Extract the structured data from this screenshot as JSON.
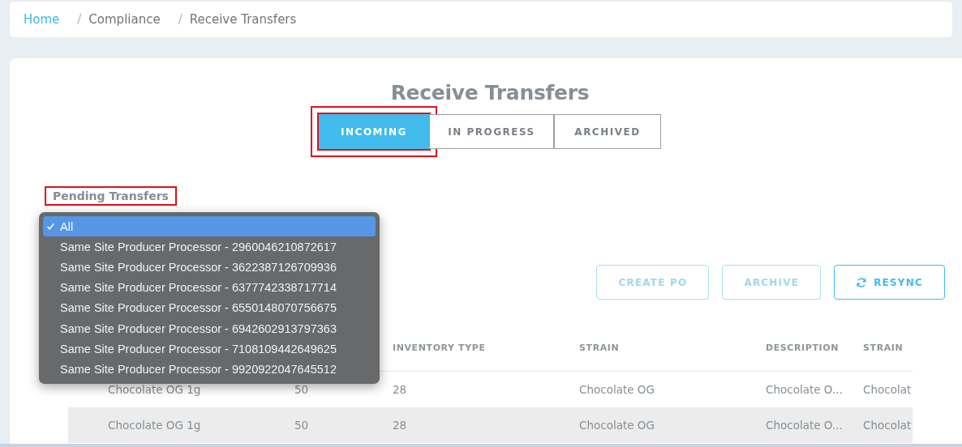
{
  "breadcrumb": [
    {
      "label": "Home",
      "link": true
    },
    {
      "separator": "/",
      "label": "Compliance",
      "link": false
    },
    {
      "separator": "/",
      "label": "Receive Transfers",
      "link": false
    }
  ],
  "title": "Receive Transfers",
  "tabs": [
    {
      "label": "INCOMING",
      "selected": true,
      "highlighted": true
    },
    {
      "label": "IN PROGRESS",
      "selected": false,
      "highlighted": false
    },
    {
      "label": "ARCHIVED",
      "selected": false,
      "highlighted": false
    }
  ],
  "filter": {
    "label": "Pending Transfers",
    "highlighted": true
  },
  "dropdown": {
    "options": [
      {
        "label": "All",
        "selected": true
      },
      {
        "label": "Same Site Producer Processor - 2960046210872617",
        "selected": false
      },
      {
        "label": "Same Site Producer Processor - 3622387126709936",
        "selected": false
      },
      {
        "label": "Same Site Producer Processor - 6377742338717714",
        "selected": false
      },
      {
        "label": "Same Site Producer Processor - 6550148070756675",
        "selected": false
      },
      {
        "label": "Same Site Producer Processor - 6942602913797363",
        "selected": false
      },
      {
        "label": "Same Site Producer Processor - 7108109442649625",
        "selected": false
      },
      {
        "label": "Same Site Producer Processor - 9920922047645512",
        "selected": false
      }
    ]
  },
  "actions": [
    {
      "label": "CREATE PO",
      "disabled": true,
      "kind": "plain"
    },
    {
      "label": "ARCHIVE",
      "disabled": true,
      "kind": "plain"
    },
    {
      "label": "RESYNC",
      "disabled": false,
      "kind": "sync"
    }
  ],
  "table": {
    "columns": [
      "",
      "",
      "INVENTORY TYPE",
      "STRAIN",
      "DESCRIPTION",
      "STRAIN"
    ],
    "rows": [
      [
        "Chocolate OG 1g",
        "50",
        "28",
        "Chocolate OG",
        "Chocolate O...",
        "Chocolat"
      ],
      [
        "Chocolate OG 1g",
        "50",
        "28",
        "Chocolate OG",
        "Chocolate O...",
        "Chocolat"
      ]
    ]
  }
}
